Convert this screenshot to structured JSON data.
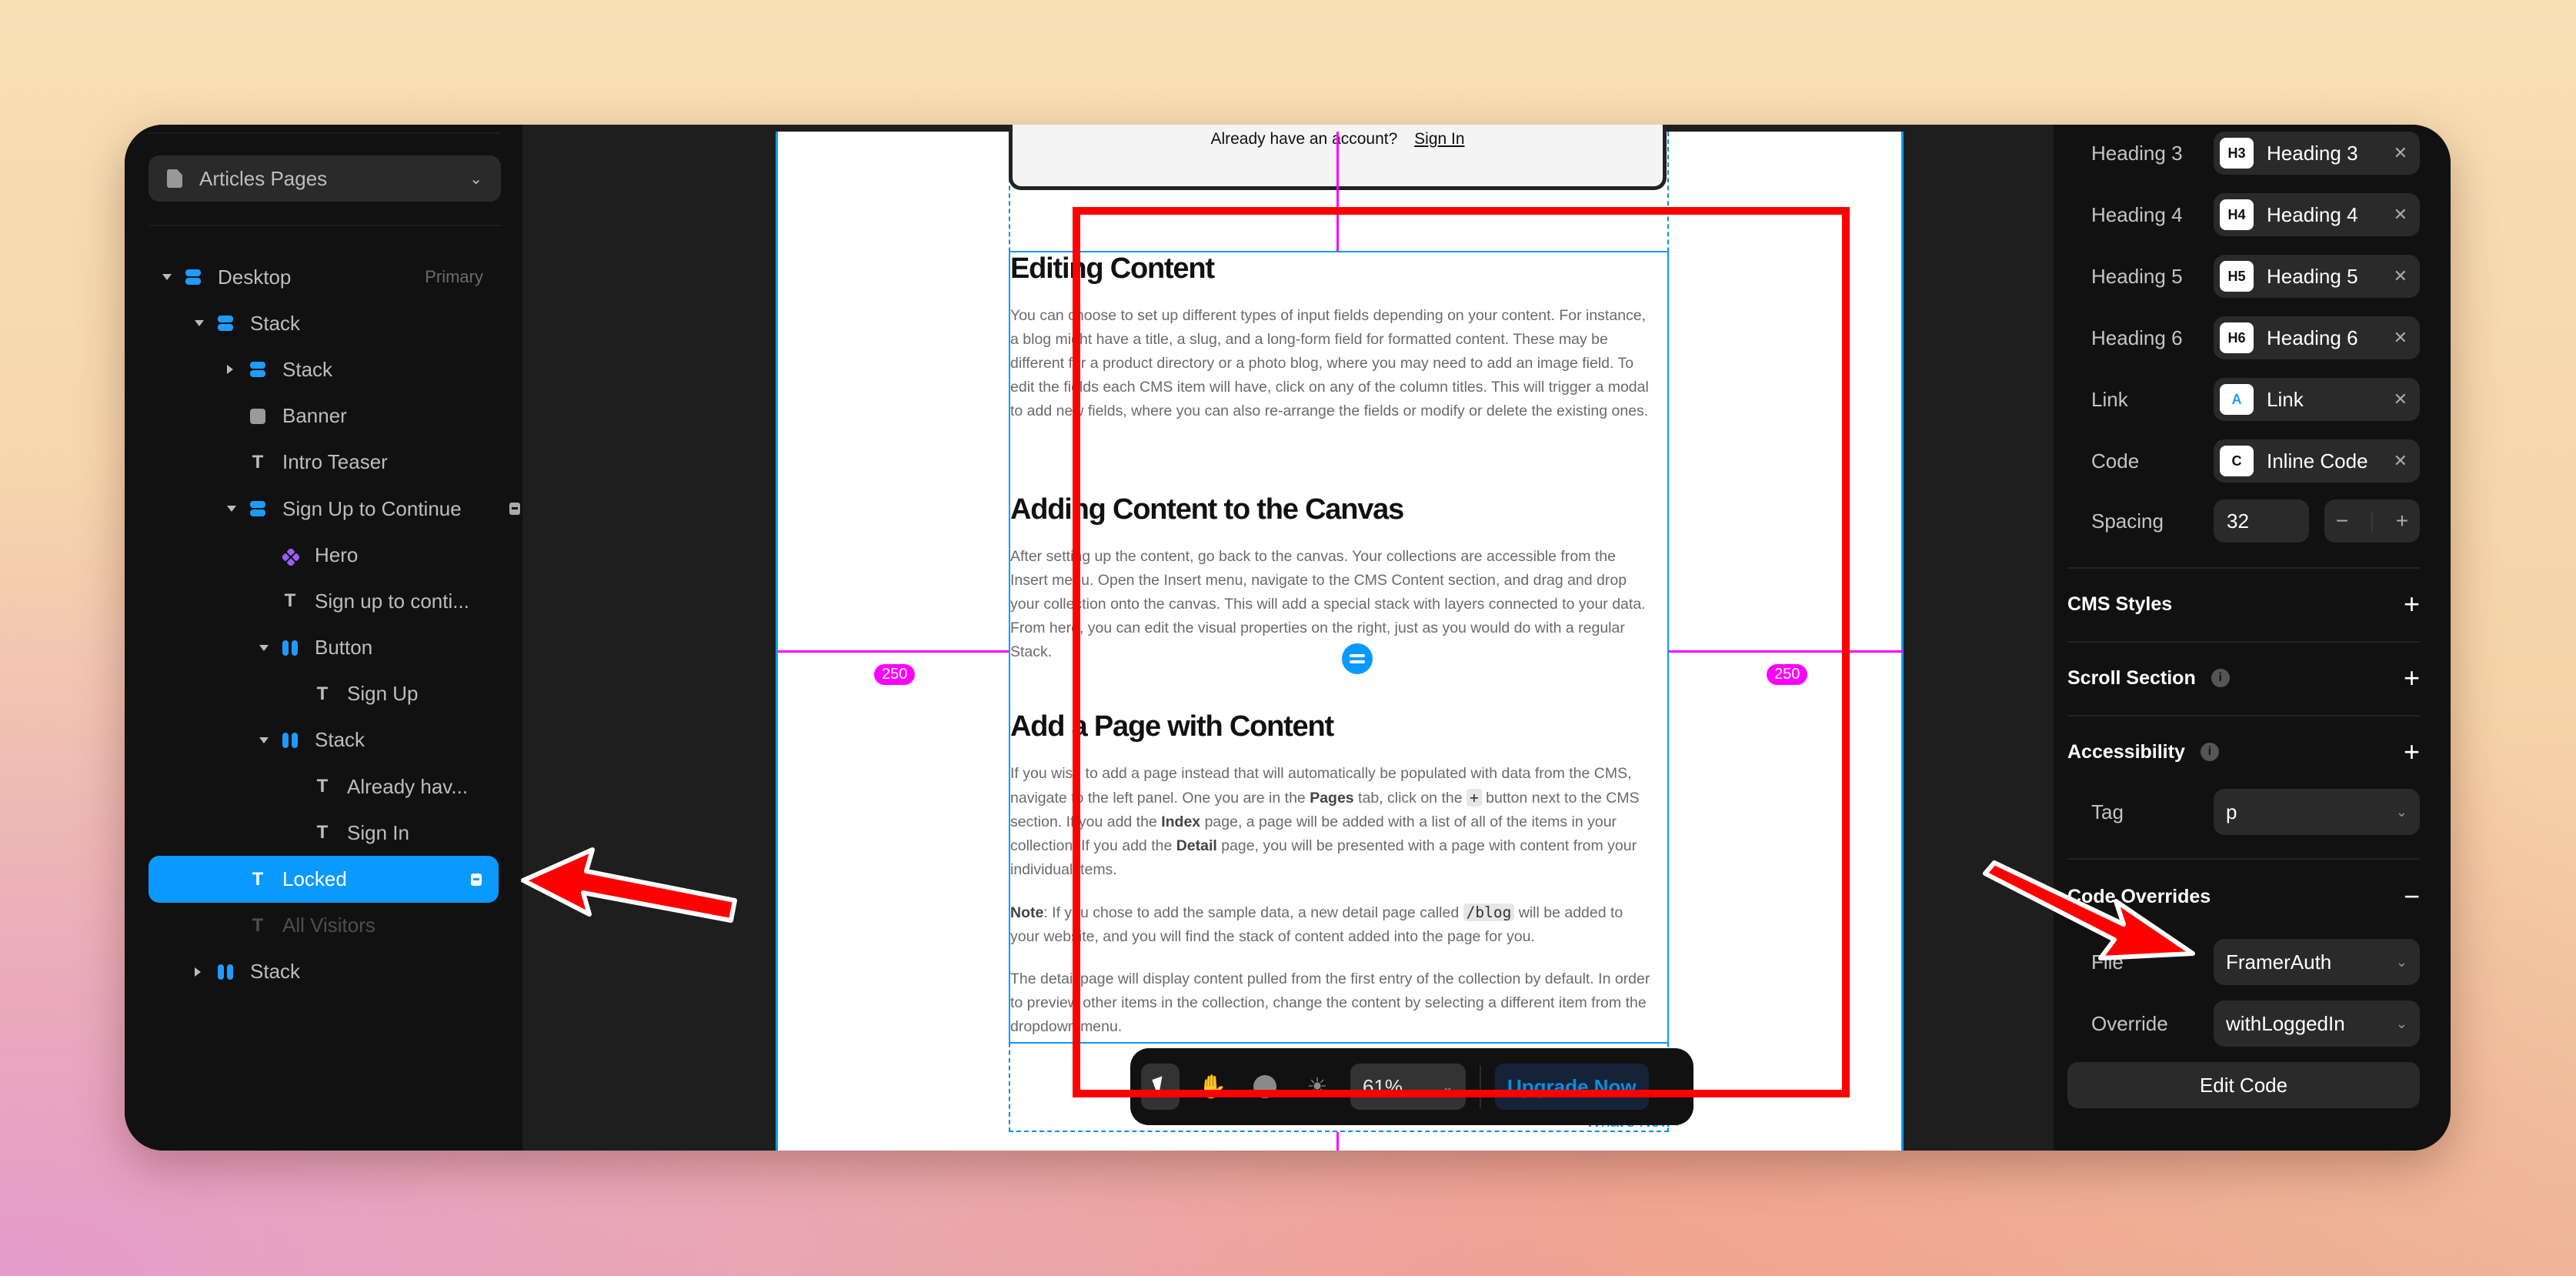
{
  "page_selector": {
    "label": "Articles Pages",
    "icon": "document-icon"
  },
  "layers": [
    {
      "label": "Desktop",
      "badge": "Primary",
      "icon": "stack-vertical-icon",
      "depth": 0,
      "expander": "down"
    },
    {
      "label": "Stack",
      "icon": "stack-vertical-icon",
      "depth": 1,
      "expander": "down"
    },
    {
      "label": "Stack",
      "icon": "stack-vertical-icon",
      "depth": 2,
      "expander": "right"
    },
    {
      "label": "Banner",
      "icon": "frame-icon",
      "depth": 2
    },
    {
      "label": "Intro Teaser",
      "icon": "text-icon",
      "depth": 2
    },
    {
      "label": "Sign Up to Continue",
      "icon": "stack-vertical-icon",
      "depth": 2,
      "expander": "down",
      "locked": true
    },
    {
      "label": "Hero",
      "icon": "component-icon",
      "depth": 3
    },
    {
      "label": "Sign up to conti...",
      "icon": "text-icon",
      "depth": 3
    },
    {
      "label": "Button",
      "icon": "stack-horizontal-icon",
      "depth": 3,
      "expander": "down"
    },
    {
      "label": "Sign Up",
      "icon": "text-icon",
      "depth": 4
    },
    {
      "label": "Stack",
      "icon": "stack-horizontal-icon",
      "depth": 3,
      "expander": "down"
    },
    {
      "label": "Already hav...",
      "icon": "text-icon",
      "depth": 4
    },
    {
      "label": "Sign In",
      "icon": "text-icon",
      "depth": 4
    },
    {
      "label": "Locked",
      "icon": "text-icon",
      "depth": 2,
      "selected": true,
      "locked": true
    },
    {
      "label": "All Visitors",
      "icon": "text-icon",
      "depth": 2,
      "hidden": true
    },
    {
      "label": "Stack",
      "icon": "stack-horizontal-icon",
      "depth": 1,
      "expander": "right"
    }
  ],
  "canvas": {
    "signin_prompt": "Already have an account?",
    "signin_link": "Sign In",
    "distance_left": "250",
    "distance_right": "250",
    "whats_new": "What's New ›",
    "sections": [
      {
        "heading": "Editing Content",
        "paragraphs": [
          "You can choose to set up different types of input fields depending on your content. For instance, a blog might have a title, a slug, and a long-form field for formatted content. These may be different for a product directory or a photo blog, where you may need to add an image field. To edit the fields each CMS item will have, click on any of the column titles. This will trigger a modal to add new fields, where you can also re-arrange the fields or modify or delete the existing ones."
        ]
      },
      {
        "heading": "Adding Content to the Canvas",
        "paragraphs": [
          "After setting up the content, go back to the canvas. Your collections are accessible from the Insert menu. Open the Insert menu, navigate to the CMS Content section, and drag and drop your collection onto the canvas. This will add a special stack with layers connected to your data. From here, you can edit the visual properties on the right, just as you would do with a regular Stack."
        ]
      },
      {
        "heading": "Add a Page with Content",
        "p1_a": "If you wish to add a page instead that will automatically be populated with data from the CMS, navigate to the left panel. One you are in the ",
        "p1_pages": "Pages",
        "p1_b": " tab, click on the ",
        "p1_plus": "+",
        "p1_c": " button next to the CMS section. If you add the ",
        "p1_index": "Index",
        "p1_d": " page, a page will be added with a list of all of the items in your collection. If you add the ",
        "p1_detail": "Detail",
        "p1_e": " page, you will be presented with a page with content from your individual items.",
        "note_label": "Note",
        "note_a": ": If you chose to add the sample data, a new detail page called ",
        "note_code": "/blog",
        "note_b": " will be added to your website, and you will find the stack of content added into the page for you.",
        "p3": "The detail page will display content pulled from the first entry of the collection by default. In order to preview other items in the collection, change the content by selecting a different item from the dropdown menu."
      }
    ]
  },
  "toolbar": {
    "tools": [
      "select-tool",
      "hand-tool",
      "preview-tool",
      "theme-tool"
    ],
    "zoom": "61%",
    "upgrade_label": "Upgrade Now"
  },
  "properties": {
    "text_styles": [
      {
        "label": "Heading 3",
        "chip": "H3",
        "name": "Heading 3"
      },
      {
        "label": "Heading 4",
        "chip": "H4",
        "name": "Heading 4"
      },
      {
        "label": "Heading 5",
        "chip": "H5",
        "name": "Heading 5"
      },
      {
        "label": "Heading 6",
        "chip": "H6",
        "name": "Heading 6"
      },
      {
        "label": "Link",
        "chip": "A",
        "name": "Link"
      },
      {
        "label": "Code",
        "chip": "C",
        "name": "Inline Code"
      }
    ],
    "spacing": {
      "label": "Spacing",
      "value": "32",
      "minus": "−",
      "plus": "+"
    },
    "sections": {
      "cms_styles": "CMS Styles",
      "scroll_section": "Scroll Section",
      "accessibility": "Accessibility",
      "code_overrides": "Code Overrides"
    },
    "tag": {
      "label": "Tag",
      "value": "p"
    },
    "file": {
      "label": "File",
      "value": "FramerAuth"
    },
    "override": {
      "label": "Override",
      "value": "withLoggedIn"
    },
    "edit_code_label": "Edit Code"
  },
  "colors": {
    "accent": "#0a99ff",
    "annotation": "#ff0000",
    "guide": "#ff00ff",
    "panel_bg": "#111111",
    "canvas_bg": "#1e1e1e"
  }
}
